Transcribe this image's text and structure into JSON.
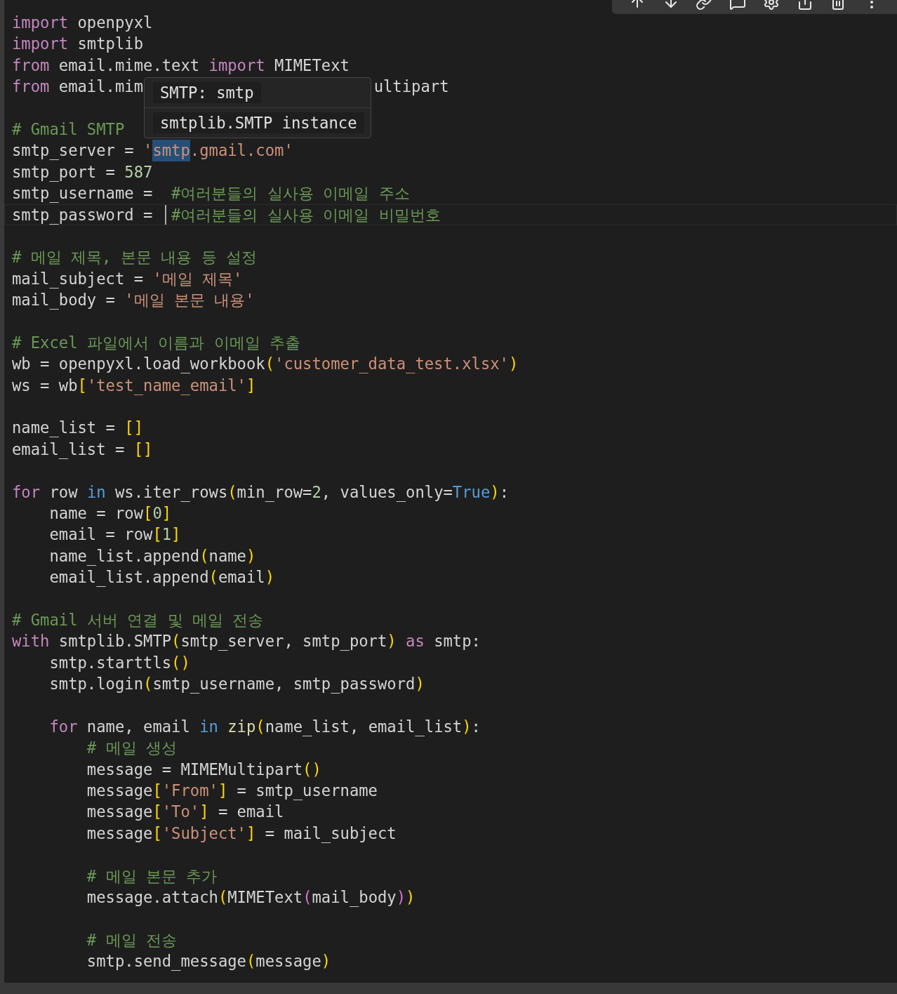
{
  "tooltip": {
    "rows": [
      "SMTP: smtp",
      "smtplib.SMTP instance"
    ]
  },
  "lines": [
    {
      "kind": "code",
      "tokens": [
        {
          "text": "import",
          "kind": "kw"
        },
        {
          "text": " openpyxl",
          "kind": "txt"
        }
      ]
    },
    {
      "kind": "code",
      "tokens": [
        {
          "text": "import",
          "kind": "kw"
        },
        {
          "text": " smtplib",
          "kind": "txt"
        }
      ]
    },
    {
      "kind": "code",
      "tokens": [
        {
          "text": "from",
          "kind": "kw"
        },
        {
          "text": " email.mime.text ",
          "kind": "txt"
        },
        {
          "text": "import",
          "kind": "kw"
        },
        {
          "text": " MIMEText",
          "kind": "txt"
        }
      ]
    },
    {
      "kind": "code",
      "tokens": [
        {
          "text": "from",
          "kind": "kw"
        },
        {
          "text": " email.mim",
          "kind": "txt"
        },
        {
          "text": "ultipart",
          "kind": "txt",
          "behind_tooltip": true
        }
      ]
    },
    {
      "kind": "blank"
    },
    {
      "kind": "code",
      "tokens": [
        {
          "text": "# Gmail SMTP",
          "kind": "com"
        }
      ]
    },
    {
      "kind": "code",
      "tokens": [
        {
          "text": "smtp_server = ",
          "kind": "txt"
        },
        {
          "text": "'",
          "kind": "str",
          "selected": false
        },
        {
          "text": "smtp",
          "kind": "str",
          "selected": true
        },
        {
          "text": ".gmail.com'",
          "kind": "str",
          "selected": false
        }
      ]
    },
    {
      "kind": "code",
      "tokens": [
        {
          "text": "smtp_port = ",
          "kind": "txt"
        },
        {
          "text": "587",
          "kind": "num"
        }
      ]
    },
    {
      "kind": "code",
      "tokens": [
        {
          "text": "smtp_username =  ",
          "kind": "txt"
        },
        {
          "text": "#여러분들의 실사용 이메일 주소",
          "kind": "com"
        }
      ]
    },
    {
      "kind": "code",
      "current": true,
      "tokens": [
        {
          "text": "smtp_password = ",
          "kind": "txt"
        },
        {
          "kind": "caret"
        },
        {
          "text": "#여러분들의 실사용 이메일 비밀번호",
          "kind": "com"
        }
      ]
    },
    {
      "kind": "blank"
    },
    {
      "kind": "code",
      "tokens": [
        {
          "text": "# 메일 제목, 본문 내용 등 설정",
          "kind": "com"
        }
      ]
    },
    {
      "kind": "code",
      "tokens": [
        {
          "text": "mail_subject = ",
          "kind": "txt"
        },
        {
          "text": "'메일 제목'",
          "kind": "str"
        }
      ]
    },
    {
      "kind": "code",
      "tokens": [
        {
          "text": "mail_body = ",
          "kind": "txt"
        },
        {
          "text": "'메일 본문 내용'",
          "kind": "str"
        }
      ]
    },
    {
      "kind": "blank"
    },
    {
      "kind": "code",
      "tokens": [
        {
          "text": "# Excel 파일에서 이름과 이메일 추출",
          "kind": "com"
        }
      ]
    },
    {
      "kind": "code",
      "tokens": [
        {
          "text": "wb = openpyxl.load_workbook",
          "kind": "txt"
        },
        {
          "text": "(",
          "kind": "br"
        },
        {
          "text": "'customer_data_test.xlsx'",
          "kind": "str"
        },
        {
          "text": ")",
          "kind": "br"
        }
      ]
    },
    {
      "kind": "code",
      "tokens": [
        {
          "text": "ws = wb",
          "kind": "txt"
        },
        {
          "text": "[",
          "kind": "br"
        },
        {
          "text": "'test_name_email'",
          "kind": "str"
        },
        {
          "text": "]",
          "kind": "br"
        }
      ]
    },
    {
      "kind": "blank"
    },
    {
      "kind": "code",
      "tokens": [
        {
          "text": "name_list = ",
          "kind": "txt"
        },
        {
          "text": "[]",
          "kind": "br"
        }
      ]
    },
    {
      "kind": "code",
      "tokens": [
        {
          "text": "email_list = ",
          "kind": "txt"
        },
        {
          "text": "[]",
          "kind": "br"
        }
      ]
    },
    {
      "kind": "blank"
    },
    {
      "kind": "code",
      "tokens": [
        {
          "text": "for",
          "kind": "kw"
        },
        {
          "text": " row ",
          "kind": "txt"
        },
        {
          "text": "in",
          "kind": "kw2"
        },
        {
          "text": " ws.iter_rows",
          "kind": "txt"
        },
        {
          "text": "(",
          "kind": "br"
        },
        {
          "text": "min_row=",
          "kind": "txt"
        },
        {
          "text": "2",
          "kind": "num"
        },
        {
          "text": ", values_only=",
          "kind": "txt"
        },
        {
          "text": "True",
          "kind": "kw2"
        },
        {
          "text": ")",
          "kind": "br"
        },
        {
          "text": ":",
          "kind": "txt"
        }
      ]
    },
    {
      "kind": "code",
      "tokens": [
        {
          "text": "    name = row",
          "kind": "txt"
        },
        {
          "text": "[",
          "kind": "br"
        },
        {
          "text": "0",
          "kind": "num"
        },
        {
          "text": "]",
          "kind": "br"
        }
      ]
    },
    {
      "kind": "code",
      "tokens": [
        {
          "text": "    email = row",
          "kind": "txt"
        },
        {
          "text": "[",
          "kind": "br"
        },
        {
          "text": "1",
          "kind": "num"
        },
        {
          "text": "]",
          "kind": "br"
        }
      ]
    },
    {
      "kind": "code",
      "tokens": [
        {
          "text": "    name_list.append",
          "kind": "txt"
        },
        {
          "text": "(",
          "kind": "br"
        },
        {
          "text": "name",
          "kind": "txt"
        },
        {
          "text": ")",
          "kind": "br"
        }
      ]
    },
    {
      "kind": "code",
      "tokens": [
        {
          "text": "    email_list.append",
          "kind": "txt"
        },
        {
          "text": "(",
          "kind": "br"
        },
        {
          "text": "email",
          "kind": "txt"
        },
        {
          "text": ")",
          "kind": "br"
        }
      ]
    },
    {
      "kind": "blank"
    },
    {
      "kind": "code",
      "tokens": [
        {
          "text": "# Gmail 서버 연결 및 메일 전송",
          "kind": "com"
        }
      ]
    },
    {
      "kind": "code",
      "tokens": [
        {
          "text": "with",
          "kind": "kw"
        },
        {
          "text": " smtplib.SMTP",
          "kind": "txt"
        },
        {
          "text": "(",
          "kind": "br"
        },
        {
          "text": "smtp_server, smtp_port",
          "kind": "txt"
        },
        {
          "text": ") ",
          "kind": "br"
        },
        {
          "text": "as",
          "kind": "kw"
        },
        {
          "text": " smtp:",
          "kind": "txt"
        }
      ]
    },
    {
      "kind": "code",
      "tokens": [
        {
          "text": "    smtp.starttls",
          "kind": "txt"
        },
        {
          "text": "()",
          "kind": "br"
        }
      ]
    },
    {
      "kind": "code",
      "tokens": [
        {
          "text": "    smtp.login",
          "kind": "txt"
        },
        {
          "text": "(",
          "kind": "br"
        },
        {
          "text": "smtp_username, smtp_password",
          "kind": "txt"
        },
        {
          "text": ")",
          "kind": "br"
        }
      ]
    },
    {
      "kind": "blank"
    },
    {
      "kind": "code",
      "tokens": [
        {
          "text": "    for",
          "kind": "kw"
        },
        {
          "text": " name, email ",
          "kind": "txt"
        },
        {
          "text": "in",
          "kind": "kw2"
        },
        {
          "text": " zip",
          "kind": "fn"
        },
        {
          "text": "(",
          "kind": "br"
        },
        {
          "text": "name_list, email_list",
          "kind": "txt"
        },
        {
          "text": ")",
          "kind": "br"
        },
        {
          "text": ":",
          "kind": "txt"
        }
      ]
    },
    {
      "kind": "code",
      "tokens": [
        {
          "text": "        # 메일 생성",
          "kind": "com"
        }
      ]
    },
    {
      "kind": "code",
      "tokens": [
        {
          "text": "        message = MIMEMultipart",
          "kind": "txt"
        },
        {
          "text": "()",
          "kind": "br"
        }
      ]
    },
    {
      "kind": "code",
      "tokens": [
        {
          "text": "        message",
          "kind": "txt"
        },
        {
          "text": "[",
          "kind": "br"
        },
        {
          "text": "'From'",
          "kind": "str"
        },
        {
          "text": "]",
          "kind": "br"
        },
        {
          "text": " = smtp_username",
          "kind": "txt"
        }
      ]
    },
    {
      "kind": "code",
      "tokens": [
        {
          "text": "        message",
          "kind": "txt"
        },
        {
          "text": "[",
          "kind": "br"
        },
        {
          "text": "'To'",
          "kind": "str"
        },
        {
          "text": "]",
          "kind": "br"
        },
        {
          "text": " = email",
          "kind": "txt"
        }
      ]
    },
    {
      "kind": "code",
      "tokens": [
        {
          "text": "        message",
          "kind": "txt"
        },
        {
          "text": "[",
          "kind": "br"
        },
        {
          "text": "'Subject'",
          "kind": "str"
        },
        {
          "text": "]",
          "kind": "br"
        },
        {
          "text": " = mail_subject",
          "kind": "txt"
        }
      ]
    },
    {
      "kind": "blank"
    },
    {
      "kind": "code",
      "tokens": [
        {
          "text": "        # 메일 본문 추가",
          "kind": "com"
        }
      ]
    },
    {
      "kind": "code",
      "tokens": [
        {
          "text": "        message.attach",
          "kind": "txt"
        },
        {
          "text": "(",
          "kind": "br"
        },
        {
          "text": "MIMEText",
          "kind": "txt"
        },
        {
          "text": "(",
          "kind": "br2"
        },
        {
          "text": "mail_body",
          "kind": "txt"
        },
        {
          "text": ")",
          "kind": "br2"
        },
        {
          "text": ")",
          "kind": "br"
        }
      ]
    },
    {
      "kind": "blank"
    },
    {
      "kind": "code",
      "tokens": [
        {
          "text": "        # 메일 전송",
          "kind": "com"
        }
      ]
    },
    {
      "kind": "code",
      "tokens": [
        {
          "text": "        smtp.send_message",
          "kind": "txt"
        },
        {
          "text": "(",
          "kind": "br"
        },
        {
          "text": "message",
          "kind": "txt"
        },
        {
          "text": ")",
          "kind": "br"
        }
      ]
    }
  ]
}
